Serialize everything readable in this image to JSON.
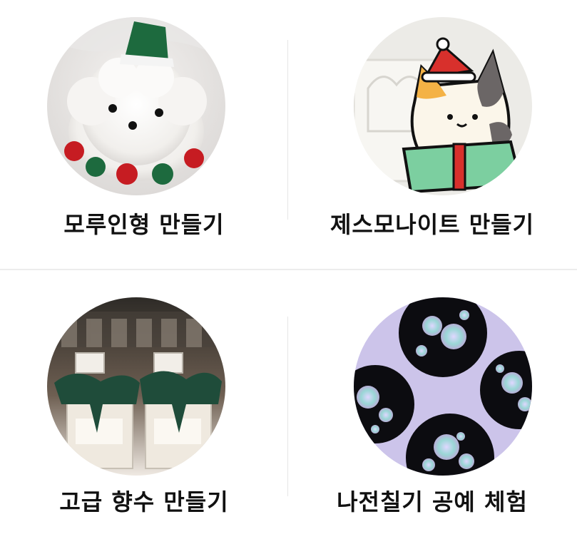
{
  "items": [
    {
      "label": "모루인형 만들기",
      "image": "fluffy-white-puppy-doll-photo"
    },
    {
      "label": "제스모나이트 만들기",
      "image": "jesmonite-cat-in-box-tray-photo"
    },
    {
      "label": "고급 향수 만들기",
      "image": "perfume-bottles-green-ribbon-photo"
    },
    {
      "label": "나전칠기 공예 체험",
      "image": "mother-of-pearl-griptok-photo"
    }
  ],
  "colors": {
    "label_text": "#111111",
    "divider": "#e6e6e6"
  }
}
